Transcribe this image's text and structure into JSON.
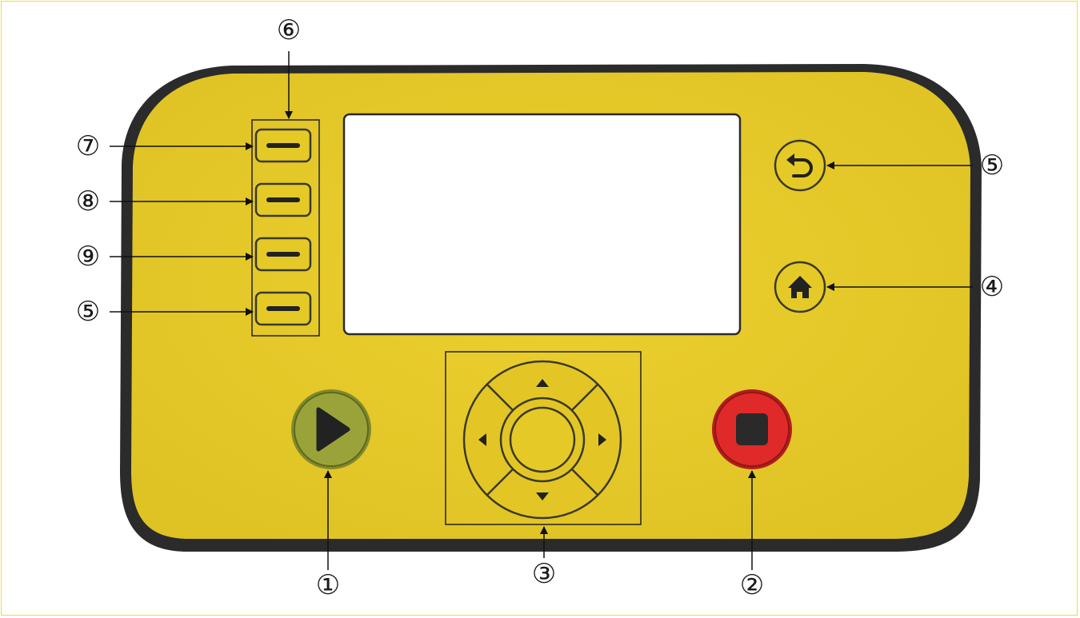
{
  "colors": {
    "panel_fill": "#e8cb29",
    "panel_edge": "#2b2b2b",
    "screen": "#ffffff",
    "start_button": "#9aa33a",
    "stop_button": "#e02a2a",
    "icon_dark": "#222222"
  },
  "callouts": {
    "start": "①",
    "stop": "②",
    "dpad": "③",
    "home": "④",
    "back": "⑤",
    "softkey_group": "⑥",
    "softkey_1": "⑦",
    "softkey_2": "⑧",
    "softkey_3": "⑨",
    "softkey_4": "⑤"
  },
  "icons": {
    "start": "play-icon",
    "stop": "stop-icon",
    "back": "undo-arrow-icon",
    "home": "home-icon",
    "dpad_up": "triangle-up-icon",
    "dpad_down": "triangle-down-icon",
    "dpad_left": "triangle-left-icon",
    "dpad_right": "triangle-right-icon"
  }
}
